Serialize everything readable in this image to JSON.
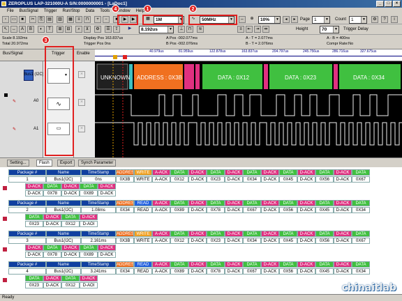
{
  "window": {
    "title": "ZEROPLUS LAP-321000U-A S/N:0000000001 - [LaDoc1]",
    "buttons": [
      "_",
      "□",
      "×"
    ]
  },
  "menu": [
    "File",
    "BusSignal",
    "Trigger",
    "Run/Stop",
    "Data",
    "Tools",
    "Window",
    "Help"
  ],
  "toolbar": {
    "sample_count": "1M",
    "sample_rate": "50MHz",
    "zoom": "10%",
    "page_label": "Page",
    "page_value": "1",
    "count_label": "Count",
    "count_value": "1",
    "time_value": "8.192us",
    "height_label": "Height",
    "height_value": "70",
    "trigger_delay_label": "Trigger Delay"
  },
  "callouts": [
    "1",
    "2",
    "3",
    "4"
  ],
  "info": {
    "scale": "Scale 8.192ms",
    "total": "Total 20.972ms",
    "display_pos": "Display Pos 163.837us",
    "trigger_pos": "Trigger Pos 0ns",
    "a_pos": "A Pos -002.077ms",
    "b_pos": "B Pos -002.076ms",
    "a_t": "A - T = 2.077ms",
    "b_t": "B - T = 2.076ms",
    "a_b": "A - B = 400ns",
    "a_b2": "A + B = 4.153ms",
    "compr": "Compr Rate:No"
  },
  "headers": {
    "bus": "Bus/Signal",
    "trigger": "Trigger",
    "enable": "Enable"
  },
  "time_ticks": [
    "40.979us",
    "81.959us",
    "122.878us",
    "163.837us",
    "204.797us",
    "245.756us",
    "286.716us",
    "327.675us"
  ],
  "signals": [
    {
      "name": "Bus1 (I2C)"
    },
    {
      "name": "A0"
    },
    {
      "name": "A1"
    }
  ],
  "bus_segments": [
    "UNKNOWN",
    "ADDRESS : 0X3B",
    "DATA : 0X12",
    "DATA : 0X23",
    "DATA : 0X34"
  ],
  "tabs": [
    "Setting...",
    "Flash",
    "Export",
    "Synch Parameter"
  ],
  "table": {
    "cols": [
      "Package #",
      "Name",
      "TimeStamp"
    ],
    "packages": [
      {
        "num": "1",
        "name": "Bus1(I2C)",
        "ts": "0ns",
        "row1": [
          "ADDRESS",
          "WRITE",
          "A-ACK",
          "DATA",
          "D-ACK",
          "DATA",
          "D-ACK",
          "DATA",
          "D-ACK",
          "DATA",
          "D-ACK",
          "DATA",
          "D-ACK",
          "DATA",
          "D-ACK"
        ],
        "row1v": [
          "0X3B",
          "WRITE",
          "A-ACK",
          "0X12",
          "D-ACK",
          "0X23",
          "D-ACK",
          "0X34",
          "D-ACK",
          "0X45",
          "D-ACK",
          "0X56",
          "D-ACK",
          "0X67"
        ],
        "row2": [
          "D-ACK",
          "DATA",
          "D-ACK",
          "DATA",
          "D-ACK"
        ],
        "row2v": [
          "D-ACK",
          "0X78",
          "D-ACK",
          "0X89",
          "D-ACK"
        ]
      },
      {
        "num": "2",
        "name": "Bus1(I2C)",
        "ts": "1.08ms",
        "row1v": [
          "0X34",
          "READ",
          "A-ACK",
          "0X89",
          "D-ACK",
          "0X78",
          "D-ACK",
          "0X67",
          "D-ACK",
          "0X56",
          "D-ACK",
          "0X45",
          "D-ACK",
          "0X34"
        ],
        "row2v": [
          "0X23",
          "D-ACK",
          "0X12",
          "D-AOI"
        ]
      },
      {
        "num": "3",
        "name": "Bus1(I2C)",
        "ts": "2.161ms",
        "row1v": [
          "0X3B",
          "WRITE",
          "A-ACK",
          "0X12",
          "D-ACK",
          "0X23",
          "D-ACK",
          "0X34",
          "D-ACK",
          "0X45",
          "D-ACK",
          "0X56",
          "D-ACK",
          "0X67"
        ],
        "row2v": [
          "D-ACK",
          "0X78",
          "D-ACK",
          "0X89",
          "D-ACK"
        ]
      },
      {
        "num": "4",
        "name": "Bus1(I2C)",
        "ts": "3.241ms",
        "row1v": [
          "0X34",
          "READ",
          "A-ACK",
          "0X89",
          "D-ACK",
          "0X78",
          "D-ACK",
          "0X67",
          "D-ACK",
          "0X56",
          "D-ACK",
          "0X45",
          "D-ACK",
          "0X34"
        ],
        "row2v": [
          "0X23",
          "D-ACK",
          "0X12",
          "D-AOI"
        ]
      }
    ]
  },
  "status": "Ready",
  "watermark": "chinaitlab",
  "colors": {
    "address": "#f07020",
    "data": "#40c040",
    "ack": "#e03080",
    "read": "#2060e0",
    "write": "#f0a020",
    "unknown": "#202020",
    "signal": "#f0f0f0"
  }
}
